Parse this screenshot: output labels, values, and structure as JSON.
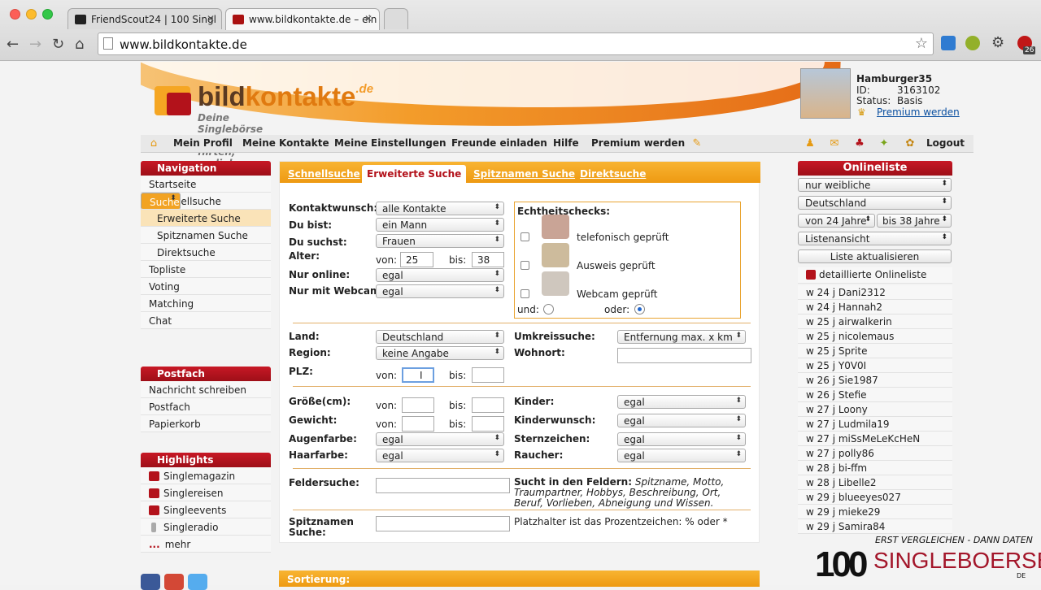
{
  "browser": {
    "tabs": [
      {
        "label": "FriendScout24 | 100 Singl"
      },
      {
        "label": "www.bildkontakte.de – ein"
      }
    ],
    "url": "www.bildkontakte.de",
    "ext_badge": "26"
  },
  "header": {
    "logo_main": "bild",
    "logo_accent": "kontakte",
    "logo_tld": ".de",
    "tagline": "Deine Singlebörse - Chatten, flirten, verlieben"
  },
  "user": {
    "name": "Hamburger35",
    "id_label": "ID:",
    "id_value": "3163102",
    "status_label": "Status:",
    "status_value": "Basis",
    "premium_link": "Premium werden"
  },
  "menu": {
    "items": [
      "Mein Profil",
      "Meine Kontakte",
      "Meine Einstellungen",
      "Freunde einladen",
      "Hilfe",
      "Premium werden"
    ],
    "logout": "Logout"
  },
  "nav": {
    "title": "Navigation",
    "items": [
      "Startseite",
      "Suche",
      "Schnellsuche",
      "Erweiterte Suche",
      "Spitznamen Suche",
      "Direktsuche",
      "Topliste",
      "Voting",
      "Matching",
      "Chat"
    ]
  },
  "postfach": {
    "title": "Postfach",
    "items": [
      "Nachricht schreiben",
      "Postfach",
      "Papierkorb"
    ]
  },
  "highlights": {
    "title": "Highlights",
    "items": [
      "Singlemagazin",
      "Singlereisen",
      "Singleevents",
      "Singleradio",
      "mehr"
    ],
    "more_prefix": "..."
  },
  "search": {
    "tabs": [
      "Schnellsuche",
      "Erweiterte Suche",
      "Spitznamen Suche",
      "Direktsuche"
    ],
    "kontaktwunsch_label": "Kontaktwunsch:",
    "kontaktwunsch_value": "alle Kontakte",
    "dubist_label": "Du bist:",
    "dubist_value": "ein Mann",
    "dusuchst_label": "Du suchst:",
    "dusuchst_value": "Frauen",
    "alter_label": "Alter:",
    "von": "von:",
    "bis": "bis:",
    "alter_von": "25",
    "alter_bis": "38",
    "nuronline_label": "Nur online:",
    "nuronline_value": "egal",
    "webcam_label": "Nur mit Webcam:",
    "webcam_value": "egal",
    "echt_title": "Echtheitschecks:",
    "echt_items": [
      "telefonisch geprüft",
      "Ausweis geprüft",
      "Webcam geprüft"
    ],
    "und": "und:",
    "oder": "oder:",
    "land_label": "Land:",
    "land_value": "Deutschland",
    "region_label": "Region:",
    "region_value": "keine Angabe",
    "plz_label": "PLZ:",
    "umkreis_label": "Umkreissuche:",
    "umkreis_value": "Entfernung max. x km",
    "wohnort_label": "Wohnort:",
    "groesse_label": "Größe(cm):",
    "gewicht_label": "Gewicht:",
    "augen_label": "Augenfarbe:",
    "augen_value": "egal",
    "haar_label": "Haarfarbe:",
    "haar_value": "egal",
    "kinder_label": "Kinder:",
    "kinder_value": "egal",
    "kinderwunsch_label": "Kinderwunsch:",
    "kinderwunsch_value": "egal",
    "stern_label": "Sternzeichen:",
    "stern_value": "egal",
    "raucher_label": "Raucher:",
    "raucher_value": "egal",
    "felder_label": "Feldersuche:",
    "felder_help_bold": "Sucht in den Feldern:",
    "felder_help": "Spitzname, Motto, Traumpartner, Hobbys, Beschreibung, Ort, Beruf, Vorlieben, Abneigung und Wissen.",
    "spitz_label_1": "Spitznamen",
    "spitz_label_2": "Suche:",
    "spitz_help": "Platzhalter ist das Prozentzeichen: % oder *",
    "sortierung": "Sortierung:"
  },
  "online": {
    "title": "Onlineliste",
    "filter_gender": "nur weibliche",
    "filter_country": "Deutschland",
    "filter_from": "von 24 Jahre",
    "filter_to": "bis 38 Jahre",
    "filter_view": "Listenansicht",
    "refresh": "Liste aktualisieren",
    "detail_link": "detaillierte Onlineliste",
    "users": [
      "w 24 j Dani2312",
      "w 24 j Hannah2",
      "w 25 j airwalkerin",
      "w 25 j nicolemaus",
      "w 25 j Sprite",
      "w 25 j Y0V0I",
      "w 26 j Sie1987",
      "w 26 j Stefie",
      "w 27 j Loony",
      "w 27 j Ludmila19",
      "w 27 j miSsMeLeKcHeN",
      "w 27 j polly86",
      "w 28 j bi-ffm",
      "w 28 j Libelle2",
      "w 29 j blueeyes027",
      "w 29 j mieke29",
      "w 29 j Samira84"
    ]
  },
  "badge": {
    "tagline": "ERST VERGLEICHEN - DANN DATEN",
    "number": "100",
    "brand": "SINGLEBOERSEN",
    "tld": "DE"
  },
  "colors": {
    "brand_red": "#b3121b",
    "brand_orange": "#f2a323"
  }
}
